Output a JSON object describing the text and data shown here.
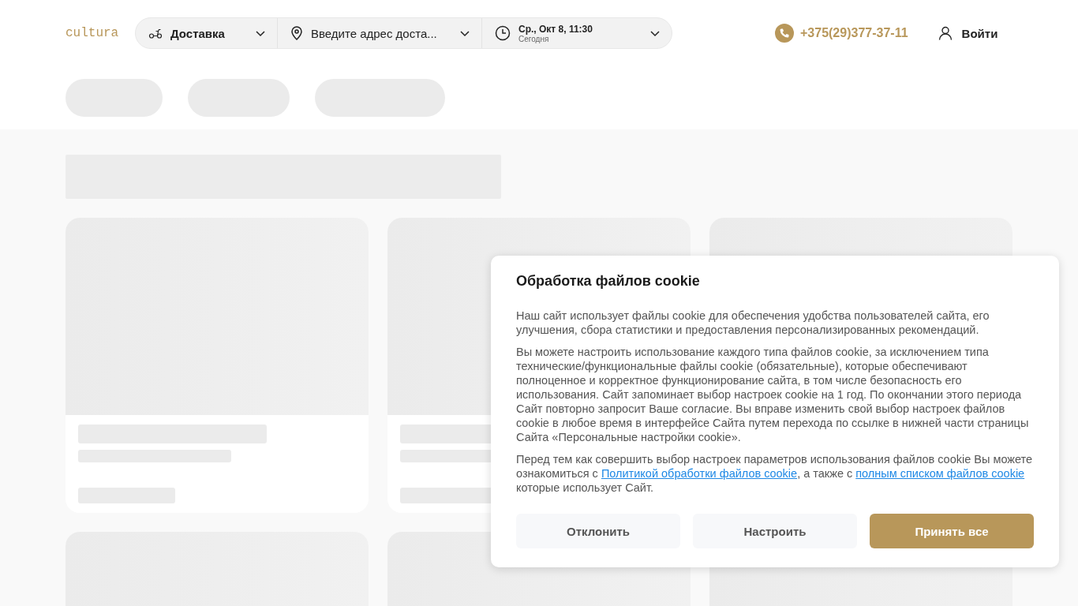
{
  "header": {
    "logo": "cultura",
    "delivery_mode": {
      "label": "Доставка"
    },
    "address": {
      "label": "Введите адрес доста..."
    },
    "time": {
      "date": "Ср., Окт 8, 11:30",
      "day": "Сегодня"
    },
    "phone": "+375(29)377-37-11",
    "login": "Войти"
  },
  "cookie_dialog": {
    "title": "Обработка файлов cookie",
    "paragraphs": [
      {
        "parts": [
          {
            "kind": "text",
            "text": "Наш сайт использует файлы cookie для обеспечения удобства пользователей сайта, его улучшения, сбора статистики и предоставления персонализированных рекомендаций."
          }
        ]
      },
      {
        "parts": [
          {
            "kind": "text",
            "text": "Вы можете настроить использование каждого типа файлов cookie, за исключением типа технические/функциональные файлы cookie (обязательные), которые обеспечивают полноценное и корректное функционирование сайта, в том числе безопасность его использования. Сайт запоминает выбор настроек cookie на 1 год. По окончании этого периода Сайт повторно запросит Ваше согласие. Вы вправе изменить свой выбор настроек файлов cookie в любое время в интерфейсе Сайта путем перехода по ссылке в нижней части страницы Сайта «Персональные настройки cookie»."
          }
        ]
      },
      {
        "parts": [
          {
            "kind": "text",
            "text": "Перед тем как совершить выбор настроек параметров использования файлов cookie Вы можете ознакомиться с "
          },
          {
            "kind": "link",
            "text": "Политикой обработки файлов cookie"
          },
          {
            "kind": "text",
            "text": ", а также с "
          },
          {
            "kind": "link",
            "text": "полным списком файлов cookie"
          },
          {
            "kind": "text",
            "text": " которые использует Сайт."
          }
        ]
      }
    ],
    "buttons": [
      {
        "label": "Отклонить",
        "kind": "secondary"
      },
      {
        "label": "Настроить",
        "kind": "secondary"
      },
      {
        "label": "Принять все",
        "kind": "primary"
      }
    ]
  }
}
